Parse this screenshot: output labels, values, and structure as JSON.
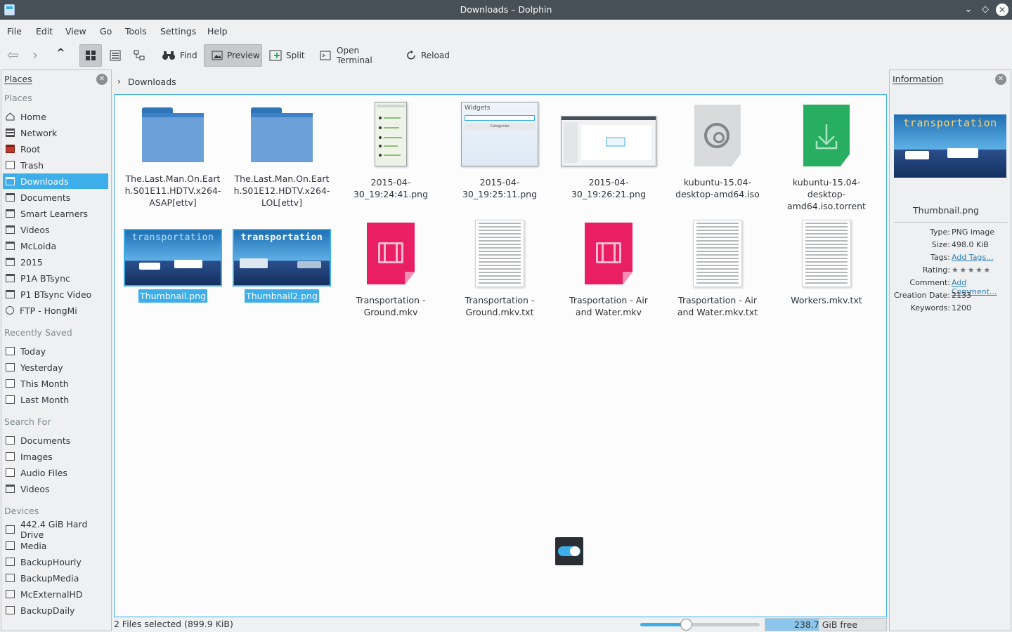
{
  "window": {
    "title": "Downloads – Dolphin"
  },
  "menu": [
    "File",
    "Edit",
    "View",
    "Go",
    "Tools",
    "Settings",
    "Help"
  ],
  "toolbar": {
    "find": "Find",
    "preview": "Preview",
    "split": "Split",
    "terminal": "Open Terminal",
    "reload": "Reload"
  },
  "places_panel": {
    "title": "Places",
    "sections": {
      "places": "Places",
      "recent": "Recently Saved",
      "search": "Search For",
      "devices": "Devices"
    },
    "places": [
      "Home",
      "Network",
      "Root",
      "Trash",
      "Downloads",
      "Documents",
      "Smart Learners",
      "Videos",
      "McLoida",
      "2015",
      "P1A BTsync",
      "P1 BTsync Video",
      "FTP - HongMi"
    ],
    "recent": [
      "Today",
      "Yesterday",
      "This Month",
      "Last Month"
    ],
    "search": [
      "Documents",
      "Images",
      "Audio Files",
      "Videos"
    ],
    "devices": [
      "442.4 GiB Hard Drive",
      "Media",
      "BackupHourly",
      "BackupMedia",
      "McExternalHD",
      "BackupDaily"
    ]
  },
  "breadcrumb": {
    "current": "Downloads"
  },
  "files": [
    {
      "name": "The.Last.Man.On.Earth.S01E11.HDTV.x264-ASAP[ettv]"
    },
    {
      "name": "The.Last.Man.On.Earth.S01E12.HDTV.x264-LOL[ettv]"
    },
    {
      "name": "2015-04-30_19:24:41.png"
    },
    {
      "name": "2015-04-30_19:25:11.png",
      "thumb_title": "Widgets",
      "thumb_button": "Categories"
    },
    {
      "name": "2015-04-30_19:26:21.png"
    },
    {
      "name": "kubuntu-15.04-desktop-amd64.iso"
    },
    {
      "name": "kubuntu-15.04-desktop-amd64.iso.torrent"
    },
    {
      "name": "Thumbnail.png",
      "thumb_word": "transportation"
    },
    {
      "name": "Thumbnail2.png",
      "thumb_word": "transportation"
    },
    {
      "name": "Transportation - Ground.mkv"
    },
    {
      "name": "Transportation - Ground.mkv.txt"
    },
    {
      "name": "Trasportation - Air and Water.mkv"
    },
    {
      "name": "Trasportation - Air and Water.mkv.txt"
    },
    {
      "name": "Workers.mkv.txt"
    }
  ],
  "info_panel": {
    "title": "Information",
    "thumb_word": "transportation",
    "file_name": "Thumbnail.png",
    "labels": {
      "type": "Type:",
      "size": "Size:",
      "tags": "Tags:",
      "rating": "Rating:",
      "comment": "Comment:",
      "creation": "Creation Date:",
      "keywords": "Keywords:"
    },
    "values": {
      "type": "PNG image",
      "size": "498.0 KiB",
      "tags": "Add Tags...",
      "rating": "★ ★ ★ ★ ★",
      "comment": "Add Comment...",
      "creation": "2133",
      "keywords": "1200"
    }
  },
  "status": {
    "selection": "2 Files selected (899.9 KiB)",
    "free": "238.7 GiB free",
    "zoom_fraction": 0.38,
    "used_fraction": 0.44
  },
  "colors": {
    "accent": "#3daee9",
    "titlebar": "#475057",
    "video": "#e91e63",
    "torrent": "#27ae60"
  }
}
